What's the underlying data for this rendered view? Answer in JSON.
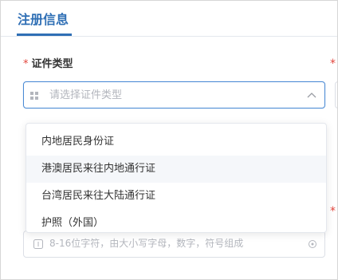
{
  "header": {
    "tab_label": "注册信息"
  },
  "form": {
    "id_type": {
      "label": "证件类型",
      "required_mark": "*",
      "placeholder": "请选择证件类型",
      "icon": "grid-icon",
      "chevron": "chevron-up-icon"
    },
    "lower_field": {
      "placeholder": "8-16位字符，由大小写字母，数字，符号组成",
      "left_icon": "info-icon",
      "right_icon": "eye-icon"
    },
    "right_required_mark": "*"
  },
  "dropdown": {
    "options": [
      {
        "label": "内地居民身份证"
      },
      {
        "label": "港澳居民来往内地通行证"
      },
      {
        "label": "台湾居民来往大陆通行证"
      },
      {
        "label": "护照（外国）"
      }
    ],
    "hovered_index": 1
  },
  "colors": {
    "accent": "#2f6fb5",
    "required": "#e2453c",
    "focus_border": "#4a8ad4",
    "placeholder": "#b3b6bd",
    "hover_bg": "#f5f7fa"
  }
}
